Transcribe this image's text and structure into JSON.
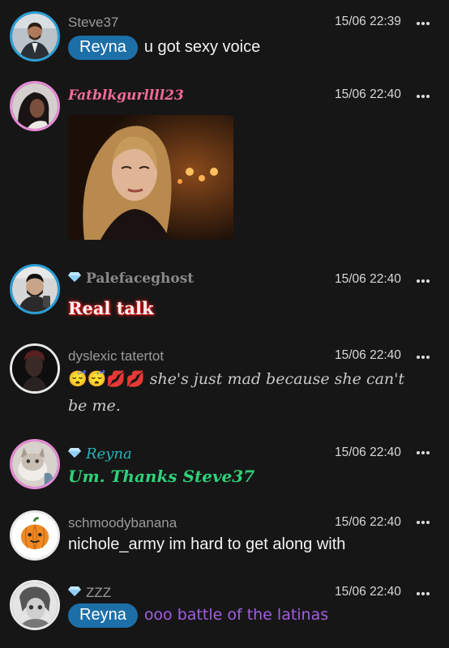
{
  "colors": {
    "background": "#161616",
    "mention_bg": "#1d6fa8",
    "username": "#9a9a9a",
    "fatblk_name": "#f06a9a",
    "reyna_name": "#27b3b8",
    "reyna_text": "#2fd17a",
    "zzz_text": "#a45de3",
    "tatertot_text": "#c9c9c9",
    "real_talk_glow": "#e02020"
  },
  "messages": [
    {
      "user": "Steve37",
      "time": "15/06 22:39",
      "mention": "Reyna",
      "text": "u got sexy voice",
      "avatar": "man-in-suit-avatar"
    },
    {
      "user": "Fatblkgurllll23",
      "time": "15/06 22:40",
      "attachment": "woman-with-blonde-hair-gif",
      "avatar": "woman-avatar"
    },
    {
      "user": "Palefaceghost",
      "time": "15/06 22:40",
      "text": "Real talk",
      "avatar": "man-selfie-avatar",
      "badge": "diamond-icon"
    },
    {
      "user": "dyslexic tatertot",
      "time": "15/06 22:40",
      "emojis": "😴😴💋💋",
      "text_line1": "she's just mad because she can't",
      "text_line2": "be me.",
      "avatar": "dark-portrait-avatar"
    },
    {
      "user": "Reyna",
      "time": "15/06 22:40",
      "text": "Um. Thanks Steve37",
      "avatar": "cat-avatar",
      "badge": "diamond-icon"
    },
    {
      "user": "schmoodybanana",
      "time": "15/06 22:40",
      "text": "nichole_army im hard to get along with",
      "avatar": "pumpkin-avatar"
    },
    {
      "user": "ZZZ",
      "time": "15/06 22:40",
      "mention": "Reyna",
      "text": "ooo battle of the latinas",
      "avatar": "sketch-avatar",
      "badge": "diamond-icon"
    }
  ]
}
